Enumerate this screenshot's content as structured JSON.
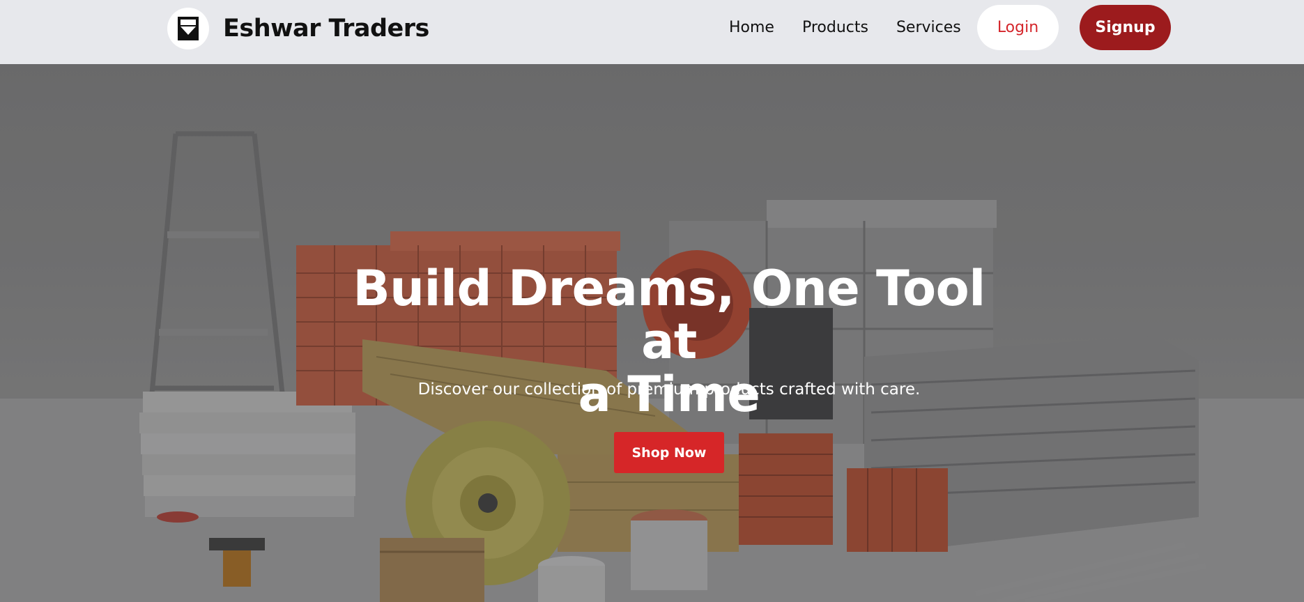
{
  "brand": {
    "name": "Eshwar Traders",
    "logo_icon": "eshwar-traders-logo"
  },
  "nav": {
    "links": [
      "Home",
      "Products",
      "Services"
    ],
    "login_label": "Login",
    "signup_label": "Signup"
  },
  "hero": {
    "title_line1": "Build Dreams, One Tool at",
    "title_line2": "a Time",
    "subtitle": "Discover our collection of premium products crafted with care.",
    "cta_label": "Shop Now",
    "background_image": "construction-materials-photo"
  },
  "colors": {
    "navbar_bg": "#e7e8ec",
    "login_text": "#d4262b",
    "signup_bg": "#9c1b1d",
    "cta_bg": "#d62628"
  }
}
